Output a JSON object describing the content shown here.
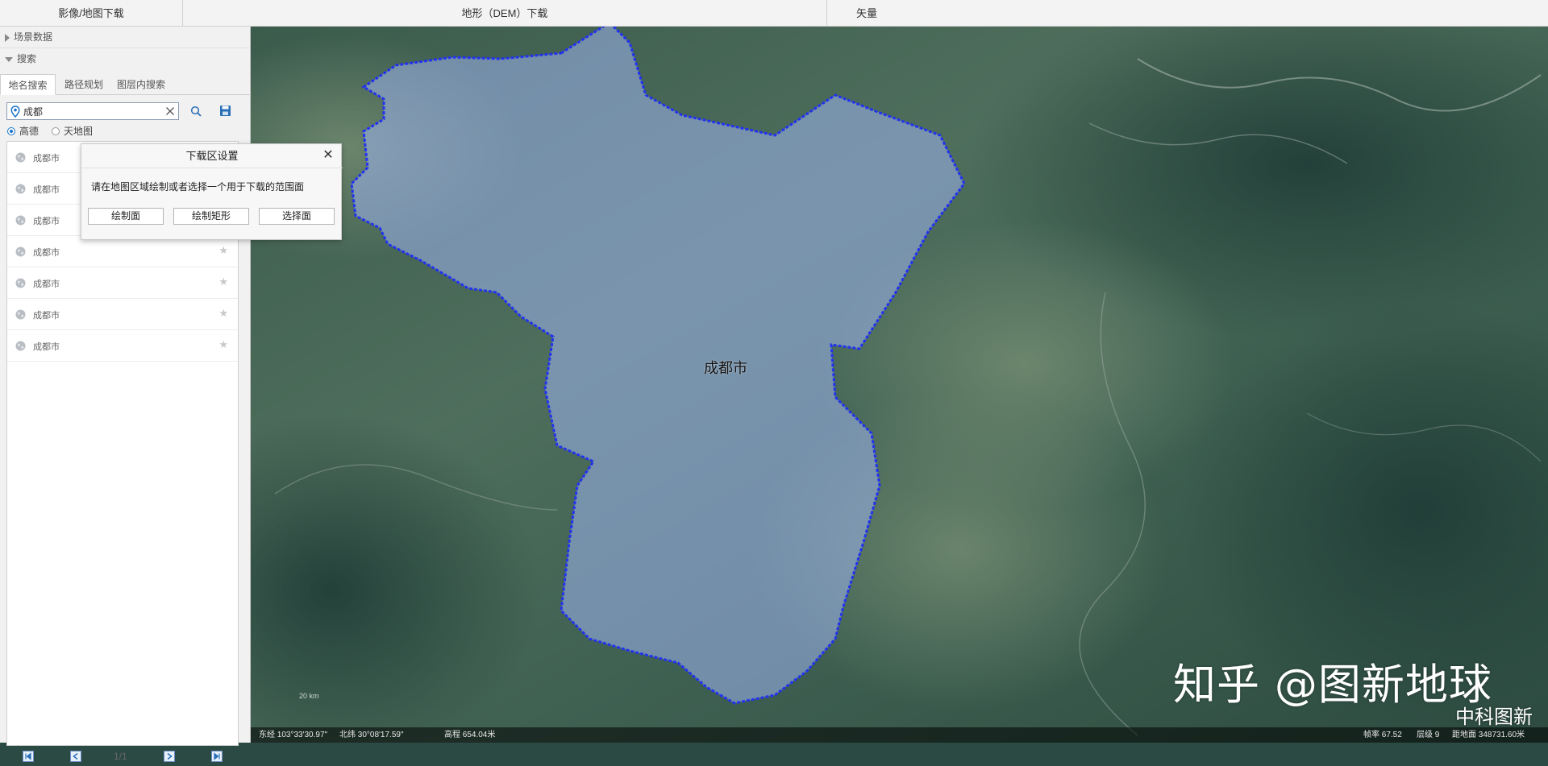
{
  "topbar": {
    "tabs": [
      {
        "label": "影像/地图下载"
      },
      {
        "label": "地形（DEM）下载"
      },
      {
        "label": "矢量"
      }
    ]
  },
  "sidebar": {
    "scene_section": "场景数据",
    "search_section": "搜索",
    "tabs": [
      {
        "label": "地名搜索",
        "active": true
      },
      {
        "label": "路径规划",
        "active": false
      },
      {
        "label": "图层内搜索",
        "active": false
      }
    ],
    "search": {
      "value": "成都"
    },
    "sources": [
      {
        "label": "高德",
        "selected": true
      },
      {
        "label": "天地图",
        "selected": false
      }
    ],
    "results": [
      {
        "name": "成都市"
      },
      {
        "name": "成都市"
      },
      {
        "name": "成都市"
      },
      {
        "name": "成都市"
      },
      {
        "name": "成都市"
      },
      {
        "name": "成都市"
      },
      {
        "name": "成都市"
      }
    ],
    "pager": {
      "page": "1/1"
    }
  },
  "dialog": {
    "title": "下载区设置",
    "message": "请在地图区域绘制或者选择一个用于下载的范围面",
    "buttons": [
      {
        "label": "绘制面"
      },
      {
        "label": "绘制矩形"
      },
      {
        "label": "选择面"
      }
    ]
  },
  "map": {
    "city_label": "成都市",
    "scale_label": "20 km",
    "boundary_color": "#2233ee",
    "fill_color": "#9fb4f0"
  },
  "status": {
    "longitude": "东经 103°33'30.97\"",
    "latitude": "北纬 30°08'17.59\"",
    "elevation": "高程 654.04米",
    "fps": "帧率 67.52",
    "level": "层级 9",
    "distance": "距地面 348731.60米"
  },
  "watermark": {
    "line1": "知乎 @图新地球",
    "line2": "中科图新"
  },
  "colors": {
    "accent": "#1a73c8",
    "sidebar_bg": "#f1f1f1"
  }
}
